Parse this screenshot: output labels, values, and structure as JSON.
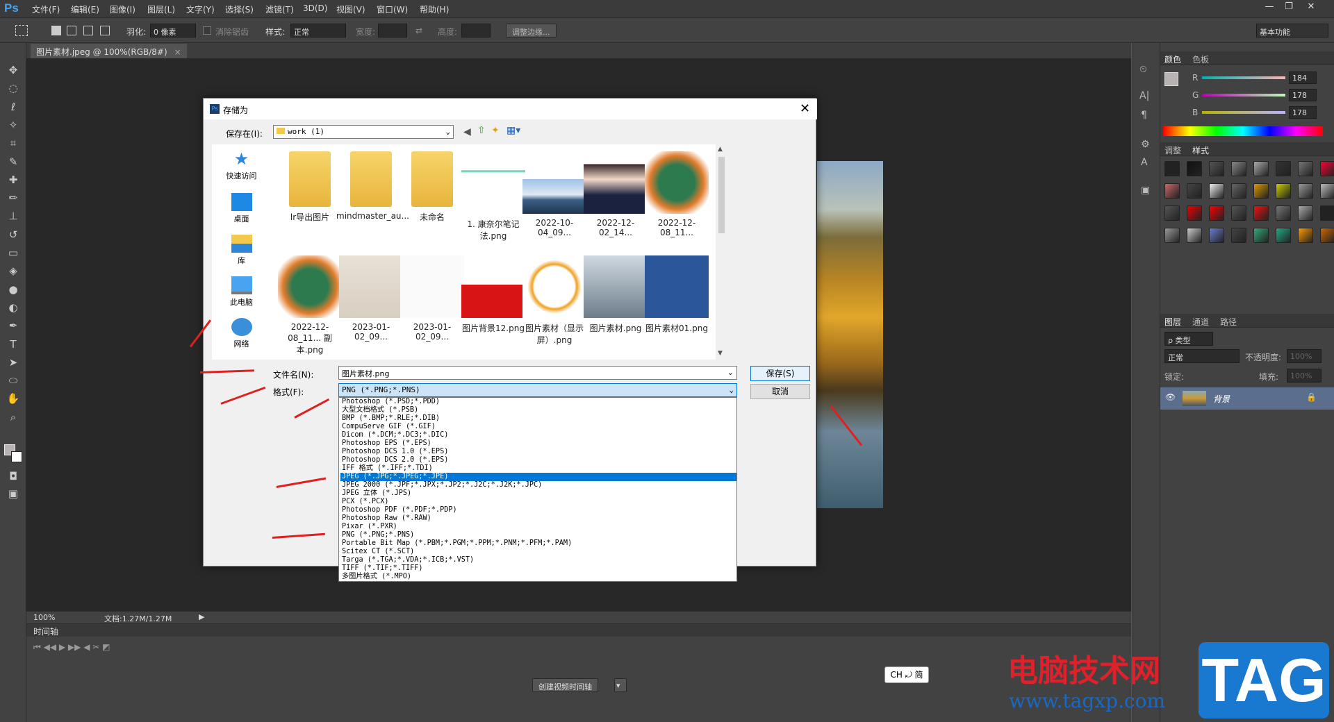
{
  "app": {
    "logo": "Ps"
  },
  "menu": [
    "文件(F)",
    "编辑(E)",
    "图像(I)",
    "图层(L)",
    "文字(Y)",
    "选择(S)",
    "滤镜(T)",
    "3D(D)",
    "视图(V)",
    "窗口(W)",
    "帮助(H)"
  ],
  "window_controls": {
    "minimize": "—",
    "restore": "❐",
    "close": "✕"
  },
  "options": {
    "feather_label": "羽化:",
    "feather_value": "0 像素",
    "antialias_label": "消除锯齿",
    "style_label": "样式:",
    "style_value": "正常",
    "width_label": "宽度:",
    "height_label": "高度:",
    "refine_edge": "调整边缘...",
    "workspace": "基本功能"
  },
  "document": {
    "tab_title": "图片素材.jpeg @ 100%(RGB/8#)",
    "zoom": "100%",
    "doc_info": "文档:1.27M/1.27M"
  },
  "timeline": {
    "title": "时间轴",
    "create_button": "创建视频时间轴"
  },
  "color_panel": {
    "tabs": [
      "颜色",
      "色板"
    ],
    "r_label": "R",
    "g_label": "G",
    "b_label": "B",
    "r": "184",
    "g": "178",
    "b": "178"
  },
  "adjust_panel": {
    "tabs": [
      "调整",
      "样式"
    ]
  },
  "layers_panel": {
    "tabs": [
      "图层",
      "通道",
      "路径"
    ],
    "filter_kind": "ρ 类型",
    "blend_mode": "正常",
    "opacity_label": "不透明度:",
    "opacity_value": "100%",
    "lock_label": "锁定:",
    "fill_label": "填充:",
    "fill_value": "100%",
    "layer_name": "背景"
  },
  "dialog": {
    "title": "存储为",
    "save_in_label": "保存在(I):",
    "save_in_value": "work (1)",
    "nav": [
      "快速访问",
      "桌面",
      "库",
      "此电脑",
      "网络"
    ],
    "files": [
      {
        "name": "lr导出图片",
        "kind": "folder"
      },
      {
        "name": "mindmaster_au...",
        "kind": "folder"
      },
      {
        "name": "未命名",
        "kind": "folder"
      },
      {
        "name": "1. 康奈尔笔记法.png",
        "kind": "mindmap"
      },
      {
        "name": "2022-10-04_09...",
        "kind": "landscape"
      },
      {
        "name": "2022-12-02_14...",
        "kind": "portrait"
      },
      {
        "name": "2022-12-08_11...",
        "kind": "board"
      },
      {
        "name": "2022-12-08_11... 副本.png",
        "kind": "board2"
      },
      {
        "name": "2023-01-02_09...",
        "kind": "sign"
      },
      {
        "name": "2023-01-02_09...",
        "kind": "sign2"
      },
      {
        "name": "图片背景12.png",
        "kind": "red"
      },
      {
        "name": "图片素材（显示屏）.png",
        "kind": "tv"
      },
      {
        "name": "图片素材.png",
        "kind": "doctor"
      },
      {
        "name": "图片素材01.png",
        "kind": "word"
      }
    ],
    "filename_label": "文件名(N):",
    "filename_value": "图片素材.png",
    "format_label": "格式(F):",
    "format_value": "PNG (*.PNG;*.PNS)",
    "save_button": "保存(S)",
    "cancel_button": "取消",
    "format_options": [
      "Photoshop (*.PSD;*.PDD)",
      "大型文档格式 (*.PSB)",
      "BMP (*.BMP;*.RLE;*.DIB)",
      "CompuServe GIF (*.GIF)",
      "Dicom (*.DCM;*.DC3;*.DIC)",
      "Photoshop EPS (*.EPS)",
      "Photoshop DCS 1.0 (*.EPS)",
      "Photoshop DCS 2.0 (*.EPS)",
      "IFF 格式 (*.IFF;*.TDI)",
      "JPEG (*.JPG;*.JPEG;*.JPE)",
      "JPEG 2000 (*.JPF;*.JPX;*.JP2;*.J2C;*.J2K;*.JPC)",
      "JPEG 立体 (*.JPS)",
      "PCX (*.PCX)",
      "Photoshop PDF (*.PDF;*.PDP)",
      "Photoshop Raw (*.RAW)",
      "Pixar (*.PXR)",
      "PNG (*.PNG;*.PNS)",
      "Portable Bit Map (*.PBM;*.PGM;*.PPM;*.PNM;*.PFM;*.PAM)",
      "Scitex CT (*.SCT)",
      "Targa (*.TGA;*.VDA;*.ICB;*.VST)",
      "TIFF (*.TIF;*.TIFF)",
      "多图片格式 (*.MPO)"
    ],
    "selected_option_index": 9
  },
  "ime": "CH ⤾ 简",
  "watermark": {
    "line1": "电脑技术网",
    "line2": "www.tagxp.com",
    "tag": "TAG"
  }
}
